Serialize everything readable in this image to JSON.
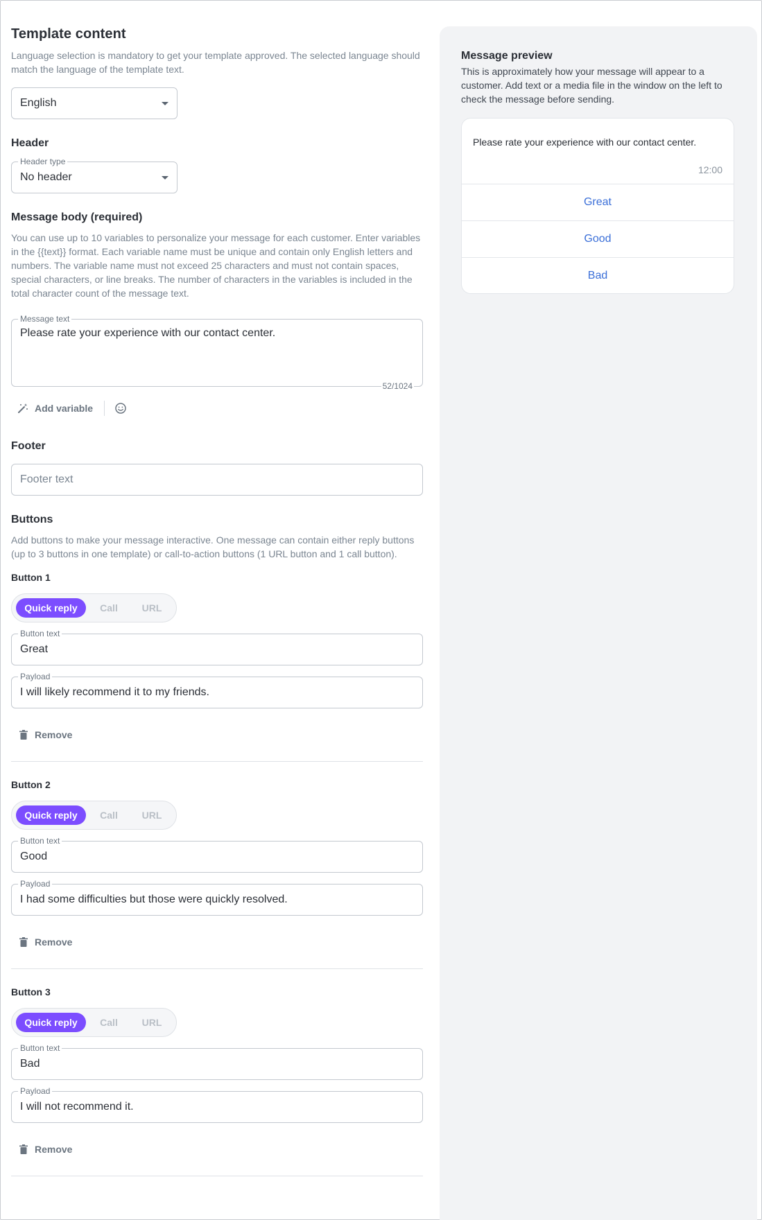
{
  "template": {
    "title": "Template content",
    "language_desc": "Language selection is mandatory to get your template approved. The selected language should match the language of the template text.",
    "language_value": "English"
  },
  "header": {
    "title": "Header",
    "type_label": "Header type",
    "type_value": "No header"
  },
  "body": {
    "title": "Message body (required)",
    "desc": "You can use up to 10 variables to personalize your message for each customer. Enter variables in the {{text}} format. Each variable name must be unique and contain only English letters and numbers. The variable name must not exceed 25 characters and must not contain spaces, special characters, or line breaks. The number of characters in the variables is included in the total character count of the message text.",
    "field_label": "Message text",
    "field_value": "Please rate your experience with our contact center.",
    "counter": "52/1024",
    "add_variable": "Add variable"
  },
  "footer": {
    "title": "Footer",
    "placeholder": "Footer text"
  },
  "buttons": {
    "title": "Buttons",
    "desc": "Add buttons to make your message interactive. One message can contain either reply buttons (up to 3 buttons in one template) or call-to-action buttons (1 URL button and 1 call button).",
    "segment_labels": {
      "quick_reply": "Quick reply",
      "call": "Call",
      "url": "URL"
    },
    "button_text_label": "Button text",
    "payload_label": "Payload",
    "remove_label": "Remove",
    "items": [
      {
        "label": "Button 1",
        "text": "Great",
        "payload": "I will likely recommend it to my friends."
      },
      {
        "label": "Button 2",
        "text": "Good",
        "payload": "I had some difficulties but those were quickly resolved."
      },
      {
        "label": "Button 3",
        "text": "Bad",
        "payload": "I will not recommend it."
      }
    ]
  },
  "preview": {
    "title": "Message preview",
    "desc": "This is approximately how your message will appear to a customer. Add text or a media file in the window on the left to check the message before sending.",
    "message": "Please rate your experience with our contact center.",
    "time": "12:00",
    "buttons": [
      "Great",
      "Good",
      "Bad"
    ]
  },
  "colors": {
    "accent": "#7c4dff",
    "preview_link": "#3b6fd8",
    "muted_text": "#7a8591",
    "preview_bg": "#f2f3f5"
  }
}
